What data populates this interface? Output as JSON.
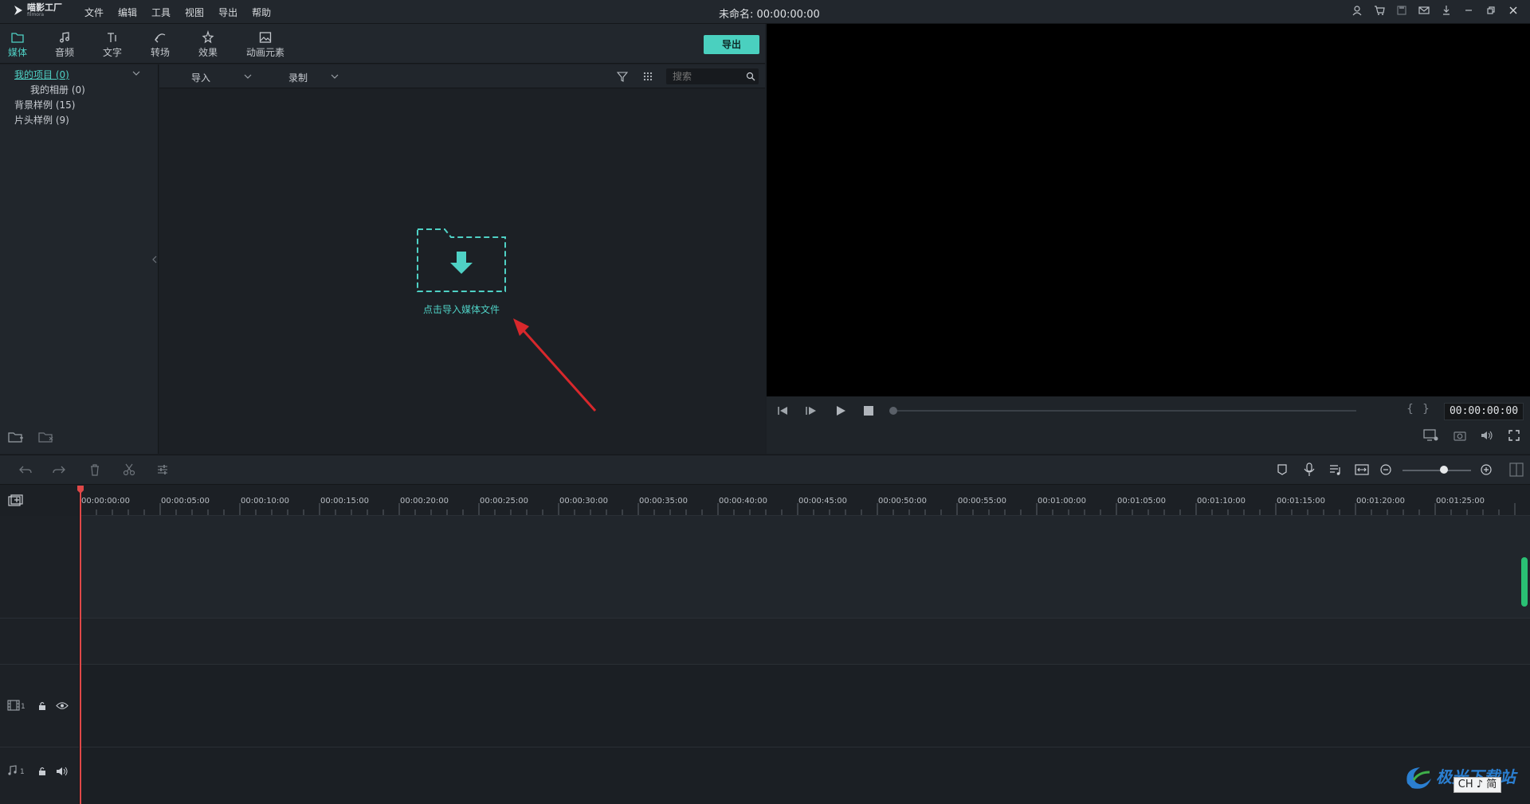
{
  "app": {
    "logo_text": "喵影工厂",
    "logo_sub": "filmora",
    "project_title": "未命名: 00:00:00:00"
  },
  "menu": [
    "文件",
    "编辑",
    "工具",
    "视图",
    "导出",
    "帮助"
  ],
  "nav_tabs": [
    {
      "label": "媒体",
      "icon": "folder-icon",
      "active": true
    },
    {
      "label": "音频",
      "icon": "music-note-icon",
      "active": false
    },
    {
      "label": "文字",
      "icon": "text-icon",
      "active": false
    },
    {
      "label": "转场",
      "icon": "transition-icon",
      "active": false
    },
    {
      "label": "效果",
      "icon": "effects-icon",
      "active": false
    },
    {
      "label": "动画元素",
      "icon": "image-icon",
      "active": false
    }
  ],
  "export_button": "导出",
  "library": {
    "items": [
      {
        "label": "我的项目 (0)",
        "selected": true
      },
      {
        "label": "我的相册 (0)",
        "selected": false
      },
      {
        "label": "背景样例 (15)",
        "selected": false
      },
      {
        "label": "片头样例 (9)",
        "selected": false
      }
    ]
  },
  "media_toolbar": {
    "import_label": "导入",
    "record_label": "录制",
    "search_placeholder": "搜索"
  },
  "import_hint": "点击导入媒体文件",
  "preview": {
    "timecode": "00:00:00:00",
    "bracket_in": "{",
    "bracket_out": "}"
  },
  "timeline": {
    "ruler_labels": [
      "00:00:00:00",
      "00:00:05:00",
      "00:00:10:00",
      "00:00:15:00",
      "00:00:20:00",
      "00:00:25:00",
      "00:00:30:00",
      "00:00:35:00",
      "00:00:40:00",
      "00:00:45:00",
      "00:00:50:00",
      "00:00:55:00",
      "00:01:00:00",
      "00:01:05:00",
      "00:01:10:00",
      "00:01:15:00",
      "00:01:20:00",
      "00:01:25:00"
    ],
    "video_track_number": "1",
    "audio_track_number": "1",
    "zoom_level": 0.6
  },
  "watermark": {
    "text": "极光下载站",
    "ime": "CH ♪ 简"
  },
  "colors": {
    "accent": "#4fd1c5",
    "playhead": "#e04848",
    "arrow": "#d8282c"
  }
}
